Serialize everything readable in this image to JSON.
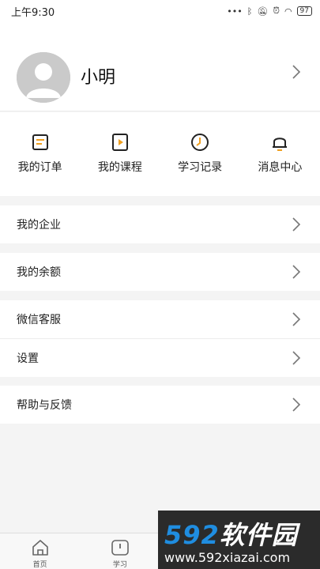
{
  "status_bar": {
    "time": "上午9:30",
    "battery": "97"
  },
  "profile": {
    "name": "小明"
  },
  "quick_actions": [
    {
      "label": "我的订单",
      "icon": "order-icon"
    },
    {
      "label": "我的课程",
      "icon": "course-icon"
    },
    {
      "label": "学习记录",
      "icon": "history-clock-icon"
    },
    {
      "label": "消息中心",
      "icon": "bell-icon"
    }
  ],
  "menu": [
    {
      "label": "我的企业"
    },
    {
      "label": "我的余额"
    },
    {
      "label": "微信客服"
    },
    {
      "label": "设置"
    },
    {
      "label": "帮助与反馈"
    }
  ],
  "tabbar": {
    "items": [
      {
        "label": "首页",
        "icon": "home-icon"
      },
      {
        "label": "学习",
        "icon": "study-icon"
      },
      {
        "label": "",
        "icon": "tab-icon"
      },
      {
        "label": "",
        "icon": "tab-icon"
      }
    ]
  },
  "watermark": {
    "brand_num": "592",
    "brand_text": "软件园",
    "url": "www.592xiazai.com"
  },
  "colors": {
    "accent": "#f0a020",
    "background": "#f4f4f4",
    "watermark_blue": "#1f8de0"
  }
}
